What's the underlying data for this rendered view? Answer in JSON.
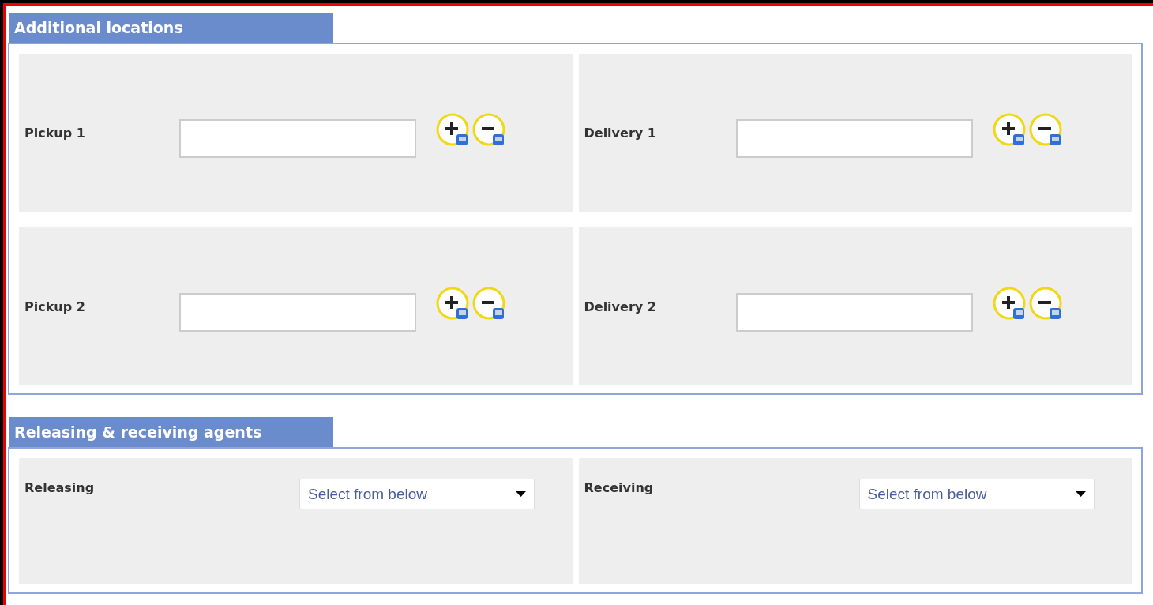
{
  "sections": [
    {
      "title": "Additional locations",
      "rows": [
        [
          {
            "kind": "text",
            "label": "Pickup 1"
          },
          {
            "kind": "text",
            "label": "Delivery 1"
          }
        ],
        [
          {
            "kind": "text",
            "label": "Pickup 2"
          },
          {
            "kind": "text",
            "label": "Delivery 2"
          }
        ]
      ]
    },
    {
      "title": "Releasing & receiving agents",
      "rows": [
        [
          {
            "kind": "select",
            "label": "Releasing",
            "value": "Select from below"
          },
          {
            "kind": "select",
            "label": "Receiving",
            "value": "Select from below"
          }
        ]
      ]
    }
  ]
}
